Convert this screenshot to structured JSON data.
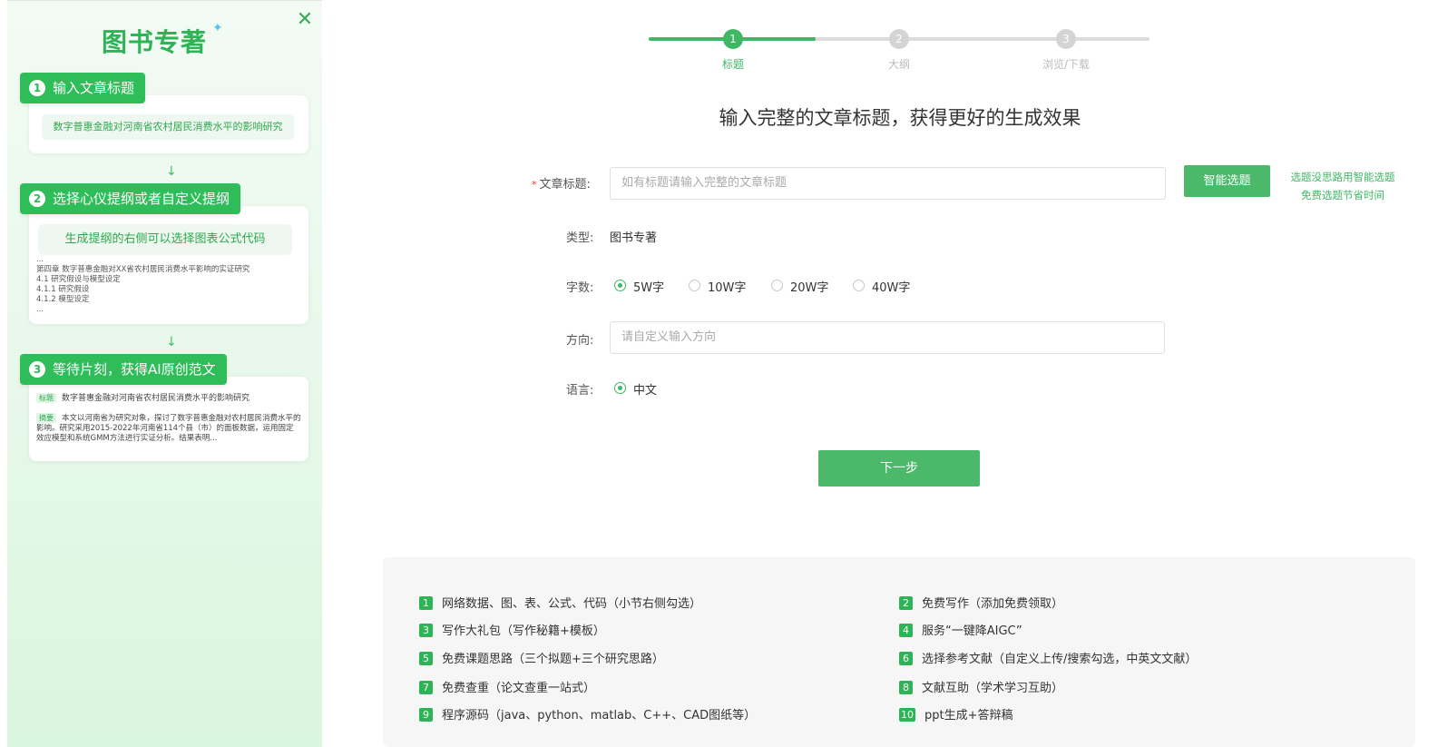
{
  "sidebar": {
    "brand": "图书专著",
    "close_icon": "close-icon",
    "steps": [
      {
        "num": "1",
        "label": "输入文章标题"
      },
      {
        "num": "2",
        "label": "选择心仪提纲或者自定义提纲"
      },
      {
        "num": "3",
        "label": "等待片刻，获得AI原创范文"
      }
    ],
    "card1_example": "数字普惠金融对河南省农村居民消费水平的影响研究",
    "card2_pill": "生成提纲的右侧可以选择图表公式代码",
    "card2_outline": [
      "...",
      "第四章 数字普惠金融对XX省农村居民消费水平影响的实证研究",
      "4.1 研究假设与模型设定",
      "4.1.1 研究假设",
      "4.1.2 模型设定",
      "..."
    ],
    "card3_tag": "标题",
    "card3_title": "数字普惠金融对河南省农村居民消费水平的影响研究",
    "card3_abstract_tag": "摘要",
    "card3_abstract": "本文以河南省为研究对象，探讨了数字普惠金融对农村居民消费水平的影响。研究采用2015-2022年河南省114个县（市）的面板数据，运用固定效应模型和系统GMM方法进行实证分析。结果表明..."
  },
  "stepper": {
    "steps": [
      {
        "num": "1",
        "label": "标题"
      },
      {
        "num": "2",
        "label": "大纲"
      },
      {
        "num": "3",
        "label": "浏览/下载"
      }
    ],
    "active_step": 1,
    "active_color": "#3fb865"
  },
  "main": {
    "headline": "输入完整的文章标题，获得更好的生成效果",
    "title_field": {
      "required_mark": "*",
      "label": "文章标题:",
      "placeholder": "如有标题请输入完整的文章标题",
      "value": ""
    },
    "smart_button": "智能选题",
    "smart_tip_line1": "选题没思路用智能选题",
    "smart_tip_line2": "免费选题节省时间",
    "type_label": "类型:",
    "type_value": "图书专著",
    "wordcount_label": "字数:",
    "wordcount_options": [
      "5W字",
      "10W字",
      "20W字",
      "40W字"
    ],
    "wordcount_selected": "5W字",
    "direction_label": "方向:",
    "direction_placeholder": "请自定义输入方向",
    "language_label": "语言:",
    "language_options": [
      "中文"
    ],
    "language_selected": "中文",
    "next_button": "下一步"
  },
  "features": [
    {
      "num": "1",
      "text": "网络数据、图、表、公式、代码（小节右侧勾选）"
    },
    {
      "num": "2",
      "text": "免费写作（添加免费领取）"
    },
    {
      "num": "3",
      "text": "写作大礼包（写作秘籍+模板）"
    },
    {
      "num": "4",
      "text": "服务“一键降AIGC”"
    },
    {
      "num": "5",
      "text": "免费课题思路（三个拟题+三个研究思路）"
    },
    {
      "num": "6",
      "text": "选择参考文献（自定义上传/搜索勾选，中英文文献）"
    },
    {
      "num": "7",
      "text": "免费查重（论文查重一站式）"
    },
    {
      "num": "8",
      "text": "文献互助（学术学习互助）"
    },
    {
      "num": "9",
      "text": "程序源码（java、python、matlab、C++、CAD图纸等）"
    },
    {
      "num": "10",
      "text": "ppt生成+答辩稿"
    }
  ],
  "colors": {
    "brand_green": "#2fb357",
    "button_green": "#4cb86a",
    "required_red": "#e4393c"
  }
}
